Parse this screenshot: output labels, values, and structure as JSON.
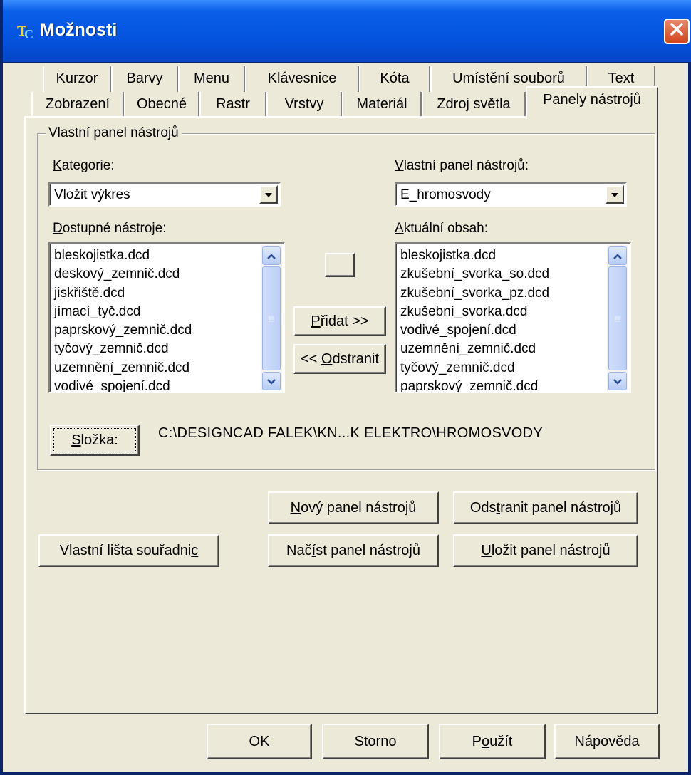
{
  "window": {
    "title": "Možnosti",
    "icon": "app-logo-icon",
    "close_icon": "close-icon"
  },
  "tabs": {
    "row1": [
      "Kurzor",
      "Barvy",
      "Menu",
      "Klávesnice",
      "Kóta",
      "Umístění souborů",
      "Text"
    ],
    "row2": [
      "Zobrazení",
      "Obecné",
      "Rastr",
      "Vrstvy",
      "Materiál",
      "Zdroj světla",
      "Panely nástrojů"
    ],
    "active": "Panely nástrojů"
  },
  "group": {
    "label": "Vlastní panel nástrojů"
  },
  "category": {
    "label_u": "K",
    "label_rest": "ategorie:",
    "value": "Vložit výkres"
  },
  "custom_toolbar": {
    "label_u": "V",
    "label_rest": "lastní panel nástrojů:",
    "value": "E_hromosvody"
  },
  "available": {
    "label_u": "D",
    "label_rest": "ostupné nástroje:",
    "items": [
      "bleskojistka.dcd",
      "deskový_zemnič.dcd",
      "jiskřiště.dcd",
      "jímací_tyč.dcd",
      "paprskový_zemnič.dcd",
      "tyčový_zemnič.dcd",
      "uzemnění_zemnič.dcd",
      "vodivé_spojení.dcd"
    ]
  },
  "current": {
    "label_u": "A",
    "label_rest": "ktuální obsah:",
    "items": [
      "bleskojistka.dcd",
      "zkušební_svorka_so.dcd",
      "zkušební_svorka_pz.dcd",
      "zkušební_svorka.dcd",
      "vodivé_spojení.dcd",
      "uzemnění_zemnič.dcd",
      "tyčový_zemnič.dcd",
      "paprskový_zemnič.dcd"
    ]
  },
  "buttons": {
    "add_u": "P",
    "add_rest": "řidat >>",
    "remove_pre": "<< ",
    "remove_u": "O",
    "remove_rest": "dstranit",
    "folder_u": "S",
    "folder_rest": "ložka:",
    "new_u": "N",
    "new_rest": "ový panel nástrojů",
    "delete_pre": "Ods",
    "delete_u": "t",
    "delete_rest": "ranit panel nástrojů",
    "coord_pre": "Vlastní lišta souřadni",
    "coord_u": "c",
    "load_pre": "Nač",
    "load_u": "í",
    "load_rest": "st panel nástrojů",
    "save_u": "U",
    "save_rest": "ložit panel nástrojů",
    "ok": "OK",
    "cancel": "Storno",
    "apply_pre": "P",
    "apply_u": "o",
    "apply_rest": "užít",
    "help": "Nápověda"
  },
  "folder_path": "C:\\DESIGNCAD FALEK\\KN...K ELEKTRO\\HROMOSVODY"
}
